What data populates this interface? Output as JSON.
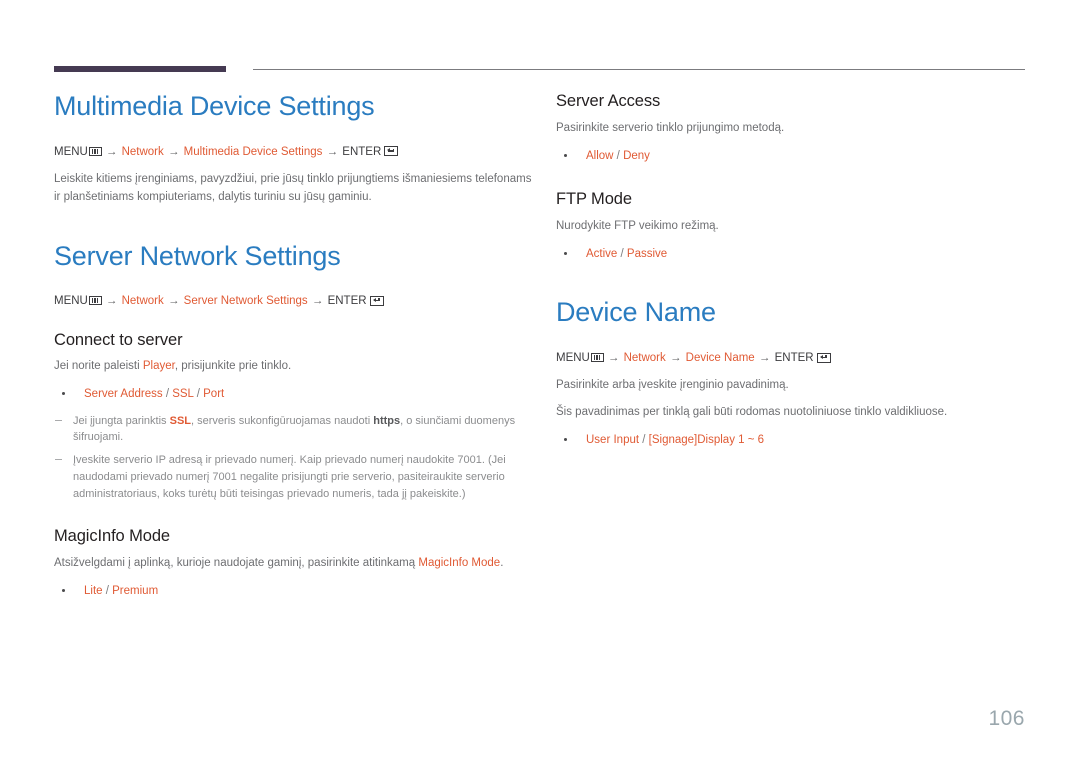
{
  "document": {
    "page_number": "106",
    "accent_blue": "#2a7cc0",
    "accent_orange": "#e05a34",
    "rule_color": "#453a52",
    "body_text_color": "#6d6e71"
  },
  "left_column": {
    "section1": {
      "heading": "Multimedia Device Settings",
      "menu_path": {
        "menu_label": "MENU",
        "menu_icon": "menu-grid-icon",
        "arrow": "→",
        "steps": [
          "Network",
          "Multimedia Device Settings"
        ],
        "enter_label": "ENTER",
        "enter_icon": "enter-return-icon"
      },
      "paragraph": "Leiskite kitiems įrenginiams, pavyzdžiui, prie jūsų tinklo prijungtiems išmaniesiems telefonams ir planšetiniams kompiuteriams, dalytis turiniu su jūsų gaminiu."
    },
    "section2": {
      "heading": "Server Network Settings",
      "menu_path": {
        "menu_label": "MENU",
        "menu_icon": "menu-grid-icon",
        "arrow": "→",
        "steps": [
          "Network",
          "Server Network Settings"
        ],
        "enter_label": "ENTER",
        "enter_icon": "enter-return-icon"
      },
      "subsection1": {
        "heading": "Connect to server",
        "paragraph_pre": "Jei norite paleisti ",
        "paragraph_hl": "Player",
        "paragraph_post": ", prisijunkite prie tinklo.",
        "options": {
          "opt1": "Server Address",
          "sep1": " / ",
          "opt2": "SSL",
          "sep2": " / ",
          "opt3": "Port"
        },
        "note1": {
          "pre": "Jei įjungta parinktis ",
          "hl": "SSL",
          "mid": ", serveris sukonfigūruojamas naudoti ",
          "bold": "https",
          "post": ", o siunčiami duomenys šifruojami."
        },
        "note2": "Įveskite serverio IP adresą ir prievado numerį. Kaip prievado numerį naudokite 7001. (Jei naudodami prievado numerį 7001 negalite prisijungti prie serverio, pasiteiraukite serverio administratoriaus, koks turėtų būti teisingas prievado numeris, tada jį pakeiskite.)"
      },
      "subsection2": {
        "heading": "MagicInfo Mode",
        "paragraph_pre": "Atsižvelgdami į aplinką, kurioje naudojate gaminį, pasirinkite atitinkamą ",
        "paragraph_hl": "MagicInfo Mode",
        "paragraph_post": ".",
        "options": {
          "opt1": "Lite",
          "sep1": " / ",
          "opt2": "Premium"
        }
      }
    }
  },
  "right_column": {
    "section1": {
      "heading": "Server Access",
      "paragraph": "Pasirinkite serverio tinklo prijungimo metodą.",
      "options": {
        "opt1": "Allow",
        "sep1": " / ",
        "opt2": "Deny"
      }
    },
    "section2": {
      "heading": "FTP Mode",
      "paragraph": "Nurodykite FTP veikimo režimą.",
      "options": {
        "opt1": "Active",
        "sep1": " / ",
        "opt2": "Passive"
      }
    },
    "section3": {
      "heading": "Device Name",
      "menu_path": {
        "menu_label": "MENU",
        "menu_icon": "menu-grid-icon",
        "arrow": "→",
        "steps": [
          "Network",
          "Device Name"
        ],
        "enter_label": "ENTER",
        "enter_icon": "enter-return-icon"
      },
      "paragraph1": "Pasirinkite arba įveskite įrenginio pavadinimą.",
      "paragraph2": "Šis pavadinimas per tinklą gali būti rodomas nuotoliniuose tinklo valdikliuose.",
      "options": {
        "opt1": "User Input",
        "sep1": " / ",
        "opt2": "[Signage]Display  1 ~ 6"
      }
    }
  }
}
